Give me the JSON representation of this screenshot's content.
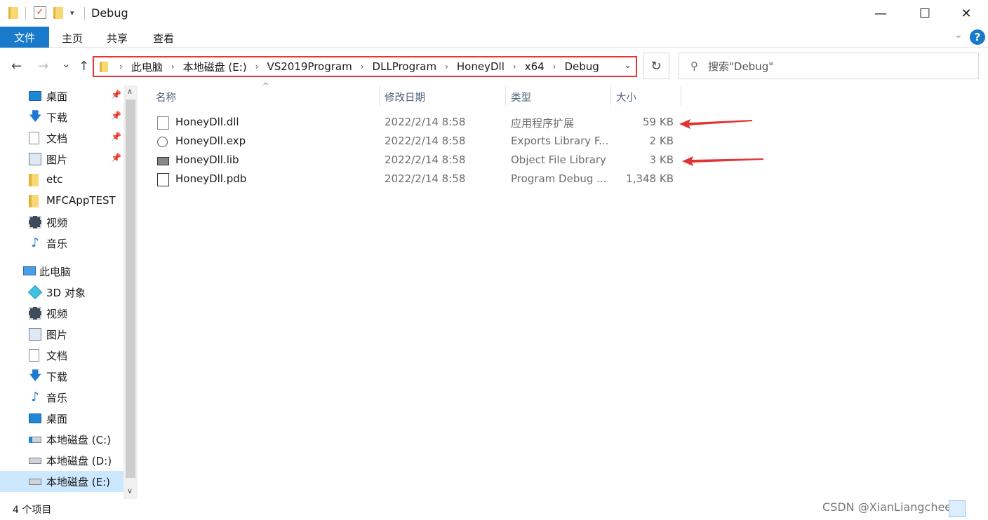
{
  "window": {
    "title": "Debug",
    "minimize": "—",
    "maximize": "☐",
    "close": "✕"
  },
  "ribbon": {
    "tabs": [
      "文件",
      "主页",
      "共享",
      "查看"
    ],
    "help": "?"
  },
  "nav": {
    "back": "←",
    "forward": "→",
    "recent": "⌄",
    "up": "↑"
  },
  "address": {
    "crumbs": [
      "此电脑",
      "本地磁盘 (E:)",
      "VS2019Program",
      "DLLProgram",
      "HoneyDll",
      "x64",
      "Debug"
    ]
  },
  "refresh": "↻",
  "search": {
    "placeholder": "搜索\"Debug\""
  },
  "sidebar": {
    "quick_access": [
      {
        "label": "桌面",
        "icon": "desktop-icon",
        "pinned": true
      },
      {
        "label": "下载",
        "icon": "download-icon",
        "pinned": true
      },
      {
        "label": "文档",
        "icon": "document-icon",
        "pinned": true
      },
      {
        "label": "图片",
        "icon": "picture-icon",
        "pinned": true
      },
      {
        "label": "etc",
        "icon": "folder-icon",
        "pinned": false
      },
      {
        "label": "MFCAppTEST",
        "icon": "folder-icon",
        "pinned": false
      },
      {
        "label": "视频",
        "icon": "video-icon",
        "pinned": false
      },
      {
        "label": "音乐",
        "icon": "music-icon",
        "pinned": false
      }
    ],
    "this_pc": "此电脑",
    "pc_items": [
      {
        "label": "3D 对象",
        "icon": "3d-objects-icon"
      },
      {
        "label": "视频",
        "icon": "video-icon"
      },
      {
        "label": "图片",
        "icon": "picture-icon"
      },
      {
        "label": "文档",
        "icon": "document-icon"
      },
      {
        "label": "下载",
        "icon": "download-icon"
      },
      {
        "label": "音乐",
        "icon": "music-icon"
      },
      {
        "label": "桌面",
        "icon": "desktop-icon"
      },
      {
        "label": "本地磁盘 (C:)",
        "icon": "drive-c-icon"
      },
      {
        "label": "本地磁盘 (D:)",
        "icon": "drive-icon"
      },
      {
        "label": "本地磁盘 (E:)",
        "icon": "drive-icon",
        "selected": true
      }
    ]
  },
  "columns": {
    "name": "名称",
    "date": "修改日期",
    "type": "类型",
    "size": "大小"
  },
  "files": [
    {
      "name": "HoneyDll.dll",
      "date": "2022/2/14 8:58",
      "type": "应用程序扩展",
      "size": "59 KB",
      "icon": "dll-file-icon",
      "highlighted": true
    },
    {
      "name": "HoneyDll.exp",
      "date": "2022/2/14 8:58",
      "type": "Exports Library F...",
      "size": "2 KB",
      "icon": "exp-file-icon",
      "highlighted": false
    },
    {
      "name": "HoneyDll.lib",
      "date": "2022/2/14 8:58",
      "type": "Object File Library",
      "size": "3 KB",
      "icon": "lib-file-icon",
      "highlighted": true
    },
    {
      "name": "HoneyDll.pdb",
      "date": "2022/2/14 8:58",
      "type": "Program Debug ...",
      "size": "1,348 KB",
      "icon": "pdb-file-icon",
      "highlighted": false
    }
  ],
  "status": {
    "count": "4 个项目",
    "watermark": "CSDN @XianLiangcheese"
  },
  "colors": {
    "accent": "#1979ca",
    "annotation": "#e33333",
    "selection": "#cce8ff"
  }
}
